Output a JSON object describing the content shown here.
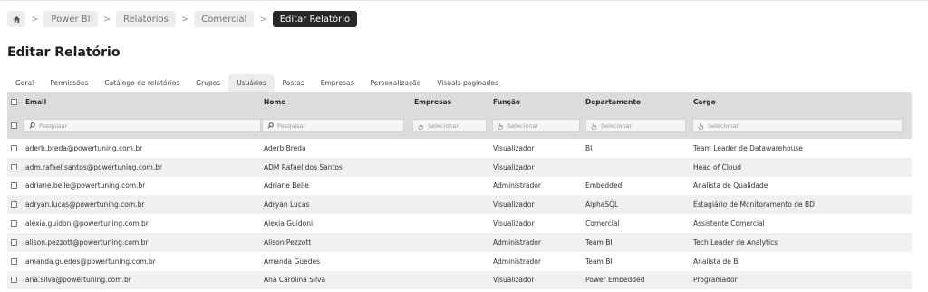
{
  "breadcrumb": {
    "home_icon": "home-icon",
    "items": [
      "Power BI",
      "Relatórios",
      "Comercial"
    ],
    "current": "Editar Relatório",
    "separator": ">"
  },
  "page_title": "Editar Relatório",
  "tabs": [
    {
      "label": "Geral",
      "active": false
    },
    {
      "label": "Permissões",
      "active": false
    },
    {
      "label": "Catálogo de relatórios",
      "active": false
    },
    {
      "label": "Grupos",
      "active": false
    },
    {
      "label": "Usuários",
      "active": true
    },
    {
      "label": "Pastas",
      "active": false
    },
    {
      "label": "Empresas",
      "active": false
    },
    {
      "label": "Personalização",
      "active": false
    },
    {
      "label": "Visuals paginados",
      "active": false
    }
  ],
  "table": {
    "columns": {
      "email": "Email",
      "nome": "Nome",
      "empresas": "Empresas",
      "funcao": "Função",
      "departamento": "Departamento",
      "cargo": "Cargo"
    },
    "filters": {
      "email": "Pesquisar",
      "nome": "Pesquisar",
      "empresas": "Selecionar",
      "funcao": "Selecionar",
      "departamento": "Selecionar",
      "cargo": "Selecionar"
    },
    "rows": [
      {
        "email": "aderb.breda@powertuning.com.br",
        "nome": "Aderb Breda",
        "empresas": "",
        "funcao": "Visualizador",
        "departamento": "BI",
        "cargo": "Team Leader de Datawarehouse"
      },
      {
        "email": "adm.rafael.santos@powertuning.com.br",
        "nome": "ADM Rafael dos Santos",
        "empresas": "",
        "funcao": "Visualizador",
        "departamento": "",
        "cargo": "Head of Cloud"
      },
      {
        "email": "adriane.belle@powertuning.com.br",
        "nome": "Adriane Belle",
        "empresas": "",
        "funcao": "Administrador",
        "departamento": "Embedded",
        "cargo": "Analista de Qualidade"
      },
      {
        "email": "adryan.lucas@powertuning.com.br",
        "nome": "Adryan Lucas",
        "empresas": "",
        "funcao": "Visualizador",
        "departamento": "AlphaSQL",
        "cargo": "Estagiário de Monitoramento de BD"
      },
      {
        "email": "alexia.guidoni@powertuning.com.br",
        "nome": "Alexia Guidoni",
        "empresas": "",
        "funcao": "Visualizador",
        "departamento": "Comercial",
        "cargo": "Assistente Comercial"
      },
      {
        "email": "alison.pezzott@powertuning.com.br",
        "nome": "Alison Pezzott",
        "empresas": "",
        "funcao": "Administrador",
        "departamento": "Team BI",
        "cargo": "Tech Leader de Analytics"
      },
      {
        "email": "amanda.guedes@powertuning.com.br",
        "nome": "Amanda Guedes",
        "empresas": "",
        "funcao": "Administrador",
        "departamento": "Team BI",
        "cargo": "Analista de BI"
      },
      {
        "email": "ana.silva@powertuning.com.br",
        "nome": "Ana Carolina Silva",
        "empresas": "",
        "funcao": "Visualizador",
        "departamento": "Power Embedded",
        "cargo": "Programador"
      }
    ]
  }
}
